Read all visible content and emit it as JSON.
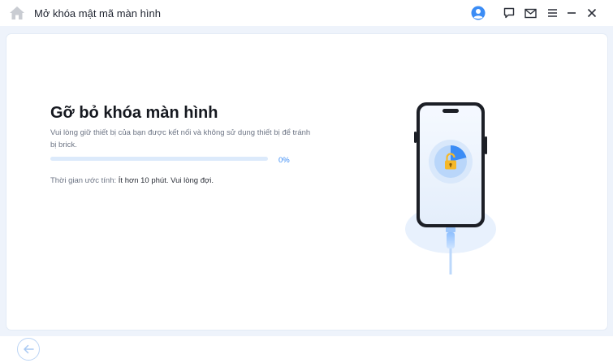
{
  "window": {
    "title": "Mở khóa mật mã màn hình",
    "icons": [
      "home-icon",
      "user-icon",
      "feedback-icon",
      "mail-icon",
      "menu-icon",
      "minimize-icon",
      "close-icon"
    ]
  },
  "main": {
    "heading": "Gỡ bỏ khóa màn hình",
    "description": "Vui lòng giữ thiết bị của bạn được kết nối và không sử dụng thiết bị để tránh bị brick.",
    "progress": {
      "value": 0,
      "label": "0%"
    },
    "time_label": "Thời gian ước tính:",
    "time_value": "Ít hơn 10 phút. Vui lòng đợi."
  },
  "colors": {
    "accent": "#3b8cf5",
    "lock": "#f5b82a",
    "background": "#eef3fb"
  },
  "footer": {
    "back_icon": "arrow-left-icon"
  }
}
